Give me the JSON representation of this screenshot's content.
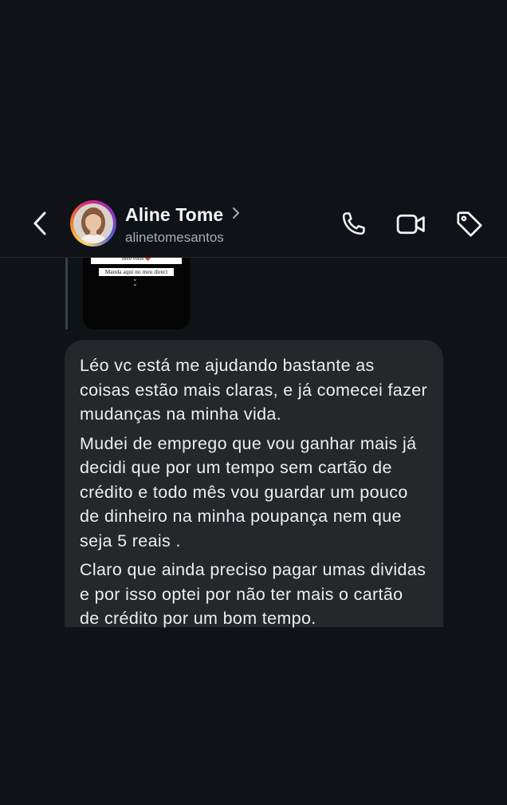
{
  "header": {
    "contact_name": "Aline Tome",
    "contact_handle": "alinetomesantos",
    "icons": {
      "back": "chevron-left-icon",
      "profile_chevron": "chevron-right-icon",
      "call": "phone-icon",
      "video": "video-camera-icon",
      "tag": "tag-icon"
    }
  },
  "story_reply": {
    "note_text": "abra seu coração aqui e me diga como. Eu sempre salvo todos os feedbacks e gosto de ouvir vocês ❤️",
    "cta_text": "Manda aqui no meu direct",
    "arrow_text": "⌄\n⌄"
  },
  "message": {
    "paragraphs": [
      "Léo vc está me ajudando bastante as coisas estão mais claras, e já comecei fazer mudanças na minha vida.",
      "Mudei de emprego que vou ganhar mais já decidi que por um tempo sem cartão de crédito e todo mês vou guardar um pouco de dinheiro na minha poupança nem que seja 5 reais .",
      "Claro que ainda preciso pagar umas dividas e por isso optei por não ter mais o cartão de crédito por um bom tempo."
    ]
  },
  "colors": {
    "background": "#0f1216",
    "bubble": "#25272b",
    "text": "#eceef1",
    "secondary_text": "#a8adb4"
  }
}
